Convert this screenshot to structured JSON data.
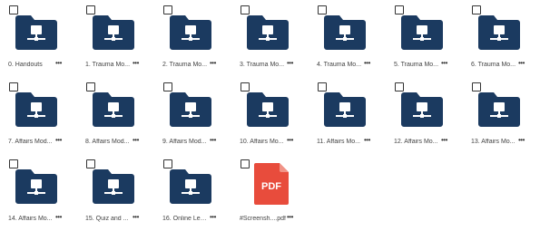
{
  "colors": {
    "folder": "#1b3a60",
    "pdf": "#e84c3c"
  },
  "icons": {
    "folder": "network-folder-icon",
    "pdf": "pdf-file-icon",
    "more": "more-options-icon"
  },
  "items": [
    {
      "type": "folder",
      "name": "0. Handouts"
    },
    {
      "type": "folder",
      "name": "1. Trauma Mo..."
    },
    {
      "type": "folder",
      "name": "2. Trauma Mo..."
    },
    {
      "type": "folder",
      "name": "3. Trauma Mo..."
    },
    {
      "type": "folder",
      "name": "4. Trauma Mo..."
    },
    {
      "type": "folder",
      "name": "5. Trauma Mo..."
    },
    {
      "type": "folder",
      "name": "6. Trauma Mo..."
    },
    {
      "type": "folder",
      "name": "7. Affairs Mod..."
    },
    {
      "type": "folder",
      "name": "8. Affairs Mod..."
    },
    {
      "type": "folder",
      "name": "9. Affairs Mod..."
    },
    {
      "type": "folder",
      "name": "10. Affairs Mo..."
    },
    {
      "type": "folder",
      "name": "11. Affairs Mo..."
    },
    {
      "type": "folder",
      "name": "12. Affairs Mo..."
    },
    {
      "type": "folder",
      "name": "13. Affairs Mo..."
    },
    {
      "type": "folder",
      "name": "14. Affairs Mo..."
    },
    {
      "type": "folder",
      "name": "15. Quiz and ..."
    },
    {
      "type": "folder",
      "name": "16. Online Lea..."
    },
    {
      "type": "pdf",
      "name": "#Screensh....pdf",
      "badge": "PDF"
    }
  ],
  "more_label": "•••"
}
